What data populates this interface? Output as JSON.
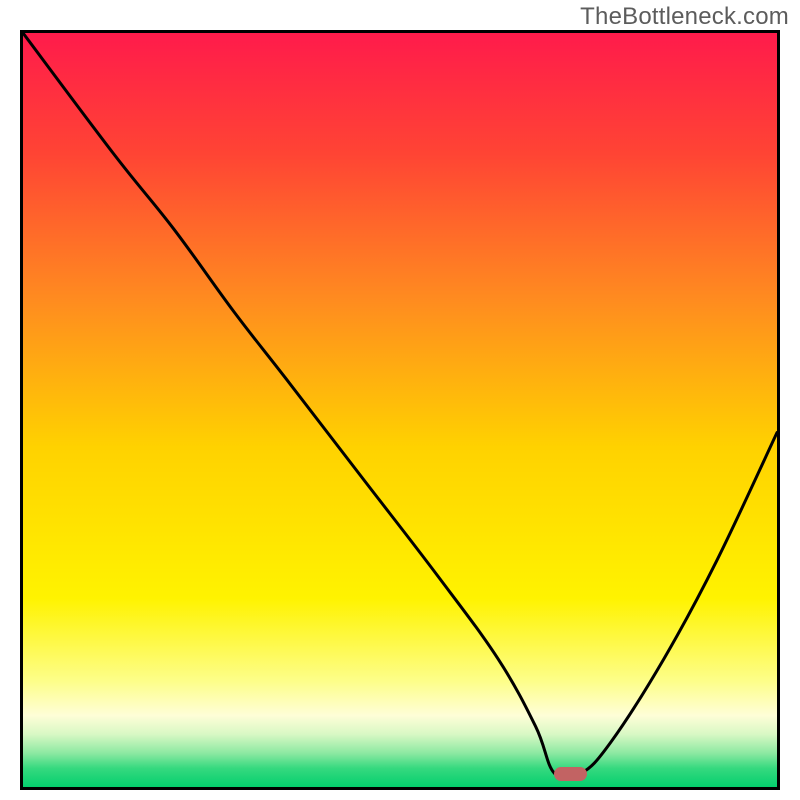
{
  "watermark": {
    "text": "TheBottleneck.com"
  },
  "chart_data": {
    "type": "line",
    "title": "",
    "xlabel": "",
    "ylabel": "",
    "xlim": [
      0,
      100
    ],
    "ylim": [
      0,
      100
    ],
    "x": [
      0,
      12,
      20,
      28,
      35,
      45,
      55,
      63,
      68,
      70.5,
      74,
      78,
      85,
      92,
      100
    ],
    "values": [
      100,
      84,
      74,
      63,
      54,
      41,
      28,
      17,
      8,
      1.8,
      1.8,
      6,
      17,
      30,
      47
    ],
    "optimum_marker": {
      "x": 72.5,
      "y": 1.7
    },
    "gradient_stops": [
      {
        "pos": 0.0,
        "color": "#ff1b4b"
      },
      {
        "pos": 0.16,
        "color": "#ff4434"
      },
      {
        "pos": 0.35,
        "color": "#ff8a20"
      },
      {
        "pos": 0.55,
        "color": "#ffd200"
      },
      {
        "pos": 0.75,
        "color": "#fff300"
      },
      {
        "pos": 0.86,
        "color": "#fdfe8a"
      },
      {
        "pos": 0.905,
        "color": "#fefed7"
      },
      {
        "pos": 0.93,
        "color": "#d8f8c4"
      },
      {
        "pos": 0.955,
        "color": "#8de9a2"
      },
      {
        "pos": 0.975,
        "color": "#36d97f"
      },
      {
        "pos": 1.0,
        "color": "#04cf6e"
      }
    ],
    "marker_color": "#c26363",
    "curve_color": "#000000"
  }
}
